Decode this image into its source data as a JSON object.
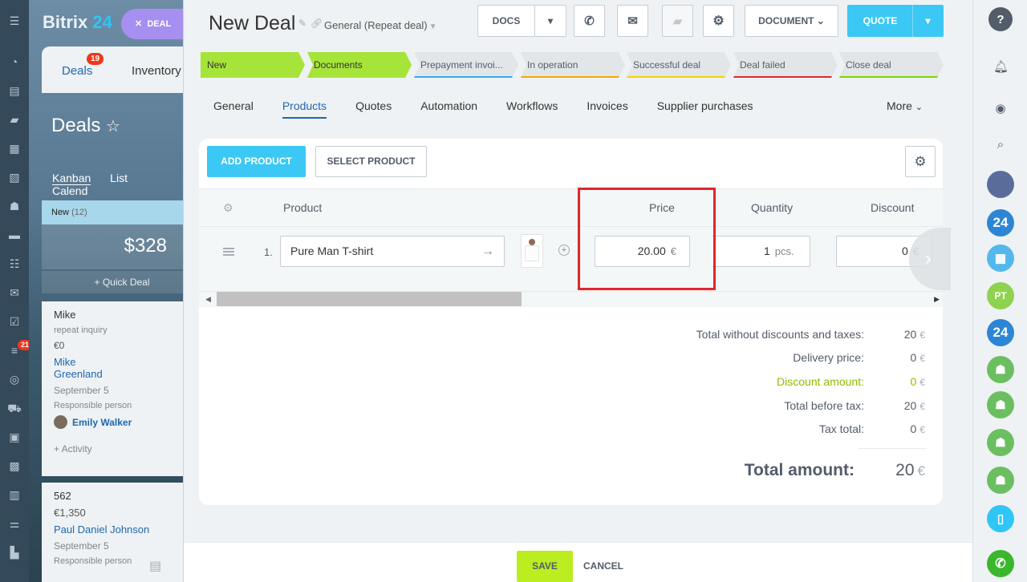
{
  "background": {
    "logo": "Bitrix",
    "logo_num": "24",
    "deal_pill": "DEAL",
    "tabs": {
      "deals": "Deals",
      "deals_badge": "19",
      "inventory": "Inventory"
    },
    "page_title": "Deals",
    "views": [
      "Kanban",
      "List",
      "Calend"
    ],
    "stage_label": "New",
    "stage_count": "(12)",
    "stage_sum": "$328",
    "quick_deal": "+ Quick Deal",
    "nav_badge": "21",
    "card1": {
      "name": "Mike",
      "subtitle": "repeat inquiry",
      "amount": "€0",
      "contact_first": "Mike",
      "contact_last": "Greenland",
      "date": "September 5",
      "resp_label": "Responsible person",
      "resp_name": "Emily Walker",
      "activity": "+ Activity"
    },
    "card2": {
      "name": "562",
      "amount": "€1,350",
      "contact": "Paul Daniel Johnson",
      "date": "September 5",
      "resp_label": "Responsible person"
    }
  },
  "header": {
    "title": "New Deal",
    "category": "General (Repeat deal)",
    "docs_label": "DOCS",
    "document_label": "DOCUMENT",
    "quote_label": "QUOTE"
  },
  "stages": [
    {
      "label": "New",
      "done": true,
      "color": "#a6e43a"
    },
    {
      "label": "Documents",
      "done": true,
      "color": "#a6e43a"
    },
    {
      "label": "Prepayment invoi...",
      "done": false,
      "color": "#39a8ef"
    },
    {
      "label": "In operation",
      "done": false,
      "color": "#f7a700"
    },
    {
      "label": "Successful deal",
      "done": false,
      "color": "#f0d600"
    },
    {
      "label": "Deal failed",
      "done": false,
      "color": "#e0262d"
    },
    {
      "label": "Close deal",
      "done": false,
      "color": "#7bd500"
    }
  ],
  "tabs": [
    "General",
    "Products",
    "Quotes",
    "Automation",
    "Workflows",
    "Invoices",
    "Supplier purchases"
  ],
  "active_tab": "Products",
  "more_label": "More",
  "toolbar": {
    "add_product": "ADD PRODUCT",
    "select_product": "SELECT PRODUCT"
  },
  "grid": {
    "columns": {
      "product": "Product",
      "price": "Price",
      "quantity": "Quantity",
      "discount": "Discount"
    },
    "row": {
      "num": "1.",
      "product": "Pure Man T-shirt",
      "price": "20.00",
      "currency": "€",
      "quantity": "1",
      "unit": "pcs.",
      "discount": "0",
      "discount_unit": "€"
    }
  },
  "totals": {
    "without_discounts_label": "Total without discounts and taxes:",
    "without_discounts_value": "20",
    "delivery_label": "Delivery price:",
    "delivery_value": "0",
    "discount_label": "Discount amount:",
    "discount_value": "0",
    "before_tax_label": "Total before tax:",
    "before_tax_value": "20",
    "tax_label": "Tax total:",
    "tax_value": "0",
    "total_label": "Total amount:",
    "total_value": "20",
    "currency": "€"
  },
  "footer": {
    "save": "SAVE",
    "cancel": "CANCEL"
  },
  "right_bar": {
    "avatar_initials": "PT",
    "b24_label": "24"
  },
  "colors": {
    "accent_blue": "#3bc8f5",
    "link_blue": "#2067b0",
    "stage_done": "#a6e43a",
    "save_green": "#bbed21",
    "highlight_red": "#e0262d"
  }
}
